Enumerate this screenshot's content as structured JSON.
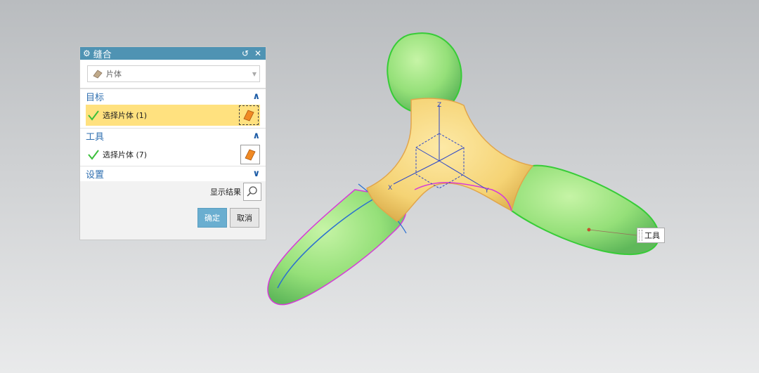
{
  "dialog": {
    "title": "缝合",
    "type_value": "片体",
    "sections": {
      "target": {
        "header": "目标",
        "select_label": "选择片体 (1)"
      },
      "tool": {
        "header": "工具",
        "select_label": "选择片体 (7)"
      },
      "settings": {
        "header": "设置"
      }
    },
    "show_result_label": "显示结果",
    "ok_label": "确定",
    "cancel_label": "取消"
  },
  "viewport": {
    "tooltip": "工具",
    "axes": {
      "x": "X",
      "y": "Y",
      "z": "Z"
    },
    "colors": {
      "sheet_green": "#9be57f",
      "target_yellow": "#f6d97d",
      "edge_magenta": "#d63ad8",
      "edge_blue": "#2b6fd0",
      "accent_blue": "#4f93b3"
    }
  }
}
